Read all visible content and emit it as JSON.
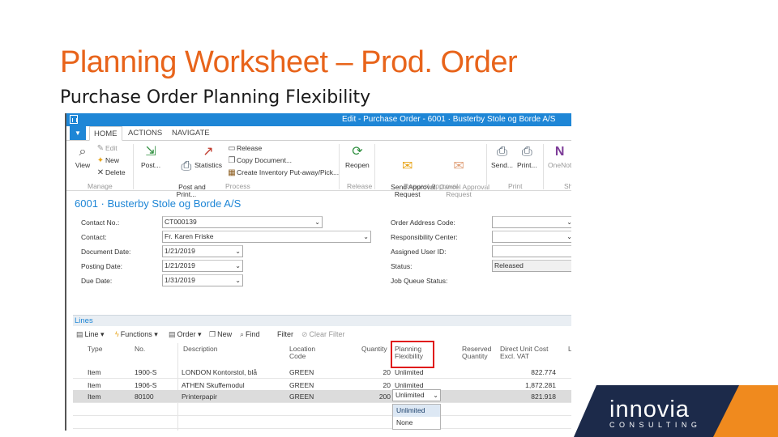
{
  "slide": {
    "title": "Planning Worksheet – Prod. Order",
    "subtitle": "Purchase Order Planning Flexibility"
  },
  "window": {
    "title": "Edit - Purchase Order - 6001 · Busterby Stole og Borde A/S",
    "accent": "#1e86d6"
  },
  "tabs": [
    "HOME",
    "ACTIONS",
    "NAVIGATE"
  ],
  "ribbon": {
    "view": "View",
    "edit": "Edit",
    "new": "New",
    "delete": "Delete",
    "manage": "Manage",
    "post": "Post...",
    "post_and_print": "Post and\nPrint...",
    "statistics": "Statistics",
    "release": "Release",
    "copy_document": "Copy Document...",
    "create_inventory": "Create Inventory Put-away/Pick...",
    "process": "Process",
    "reopen": "Reopen",
    "release_group": "Release",
    "send_approval": "Send Approval\nRequest",
    "cancel_approval": "Cancel Approval\nRequest",
    "request_approval": "Request Approval",
    "send": "Send...",
    "print": "Print...",
    "print_group": "Print",
    "onenote": "OneNot",
    "share_group": "Sh"
  },
  "record_title": "6001 · Busterby Stole og Borde A/S",
  "fields_left": [
    {
      "label": "Contact No.:",
      "value": "CT000139"
    },
    {
      "label": "Contact:",
      "value": "Fr. Karen Friske"
    },
    {
      "label": "Document Date:",
      "value": "1/21/2019"
    },
    {
      "label": "Posting Date:",
      "value": "1/21/2019"
    },
    {
      "label": "Due Date:",
      "value": "1/31/2019"
    }
  ],
  "fields_right": [
    {
      "label": "Order Address Code:",
      "value": ""
    },
    {
      "label": "Responsibility Center:",
      "value": ""
    },
    {
      "label": "Assigned User ID:",
      "value": ""
    },
    {
      "label": "Status:",
      "value": "Released"
    },
    {
      "label": "Job Queue Status:",
      "value": ""
    }
  ],
  "lines": {
    "header": "Lines",
    "toolbar": {
      "line": "Line",
      "functions": "Functions",
      "order": "Order",
      "new": "New",
      "find": "Find",
      "filter": "Filter",
      "clear_filter": "Clear Filter"
    },
    "columns": {
      "type": "Type",
      "no": "No.",
      "description": "Description",
      "location": "Location\nCode",
      "quantity": "Quantity",
      "planning_flex": "Planning\nFlexibility",
      "reserved": "Reserved\nQuantity",
      "direct_cost": "Direct Unit Cost\nExcl. VAT",
      "extra": "L"
    },
    "rows": [
      {
        "type": "Item",
        "no": "1900-S",
        "description": "LONDON Kontorstol, blå",
        "location": "GREEN",
        "quantity": "20",
        "flex": "Unlimited",
        "cost": "822.774"
      },
      {
        "type": "Item",
        "no": "1906-S",
        "description": "ATHEN Skuffemodul",
        "location": "GREEN",
        "quantity": "20",
        "flex": "Unlimited",
        "cost": "1,872.281"
      },
      {
        "type": "Item",
        "no": "80100",
        "description": "Printerpapir",
        "location": "GREEN",
        "quantity": "200",
        "flex": "Unlimited",
        "cost": "821.918"
      }
    ],
    "dropdown_options": [
      "Unlimited",
      "None"
    ]
  },
  "logo": {
    "word": "innovia",
    "sub": "CONSULTING",
    "navy": "#1c2a4a",
    "orange": "#f08a1e"
  }
}
